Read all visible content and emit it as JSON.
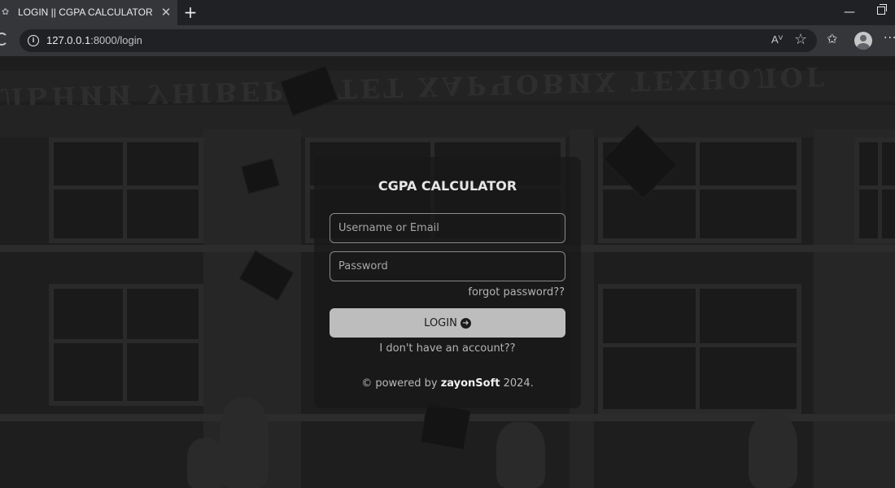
{
  "browser": {
    "tab_title": "LOGIN || CGPA CALCULATOR",
    "url_host": "127.0.0.1",
    "url_rest": ":8000/login",
    "read_aloud_label": "Aⱽ"
  },
  "login": {
    "title": "CGPA CALCULATOR",
    "username_placeholder": "Username or Email",
    "password_placeholder": "Password",
    "forgot_link": "forgot password??",
    "login_button": "LOGIN",
    "signup_link": "I don't have an account??",
    "footer_prefix": "© powered by",
    "footer_brand": "zayonSoft",
    "footer_year": "2024."
  },
  "background": {
    "banner_text": "ЛЬНИЙ УНІВЕРСИТЕТ ХАРЧОВИХ ТЕХНОЛОГ"
  }
}
